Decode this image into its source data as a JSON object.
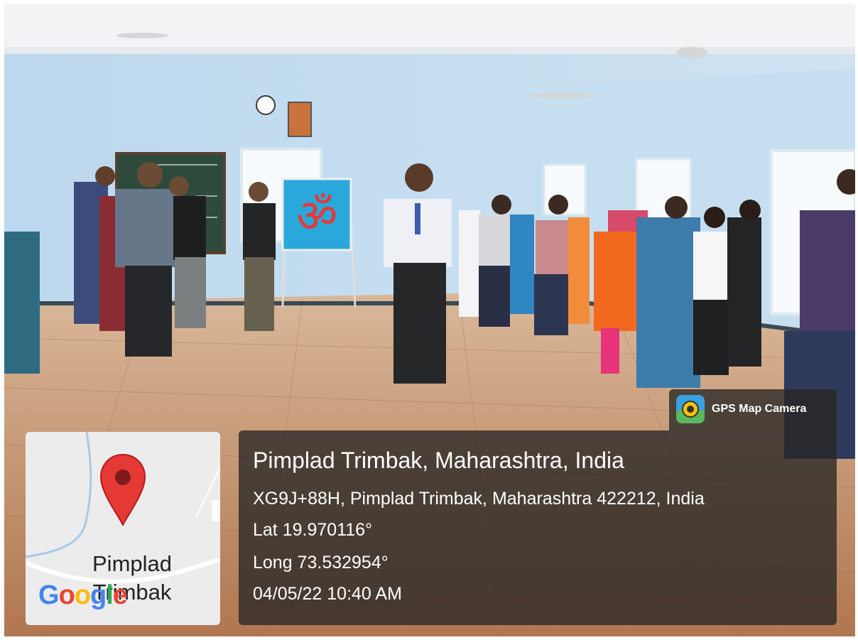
{
  "overlay": {
    "app_name": "GPS Map Camera",
    "location_title": "Pimplad Trimbak, Maharashtra, India",
    "address": "XG9J+88H, Pimplad Trimbak, Maharashtra 422212, India",
    "latitude": "Lat 19.970116°",
    "longitude": "Long 73.532954°",
    "datetime": "04/05/22 10:40 AM"
  },
  "map": {
    "place_line1": "Pimplad",
    "place_line2": "Trimbak",
    "logo_letters": [
      {
        "ch": "G",
        "color": "#4285F4"
      },
      {
        "ch": "o",
        "color": "#EA4335"
      },
      {
        "ch": "o",
        "color": "#FBBC05"
      },
      {
        "ch": "g",
        "color": "#4285F4"
      },
      {
        "ch": "l",
        "color": "#34A853"
      },
      {
        "ch": "e",
        "color": "#EA4335"
      }
    ],
    "pin_color": "#E53935"
  },
  "scene": {
    "icons": [
      "wall-clock-icon",
      "om-poster-icon",
      "portrait-frame-icon",
      "ceiling-fan-icon"
    ]
  }
}
